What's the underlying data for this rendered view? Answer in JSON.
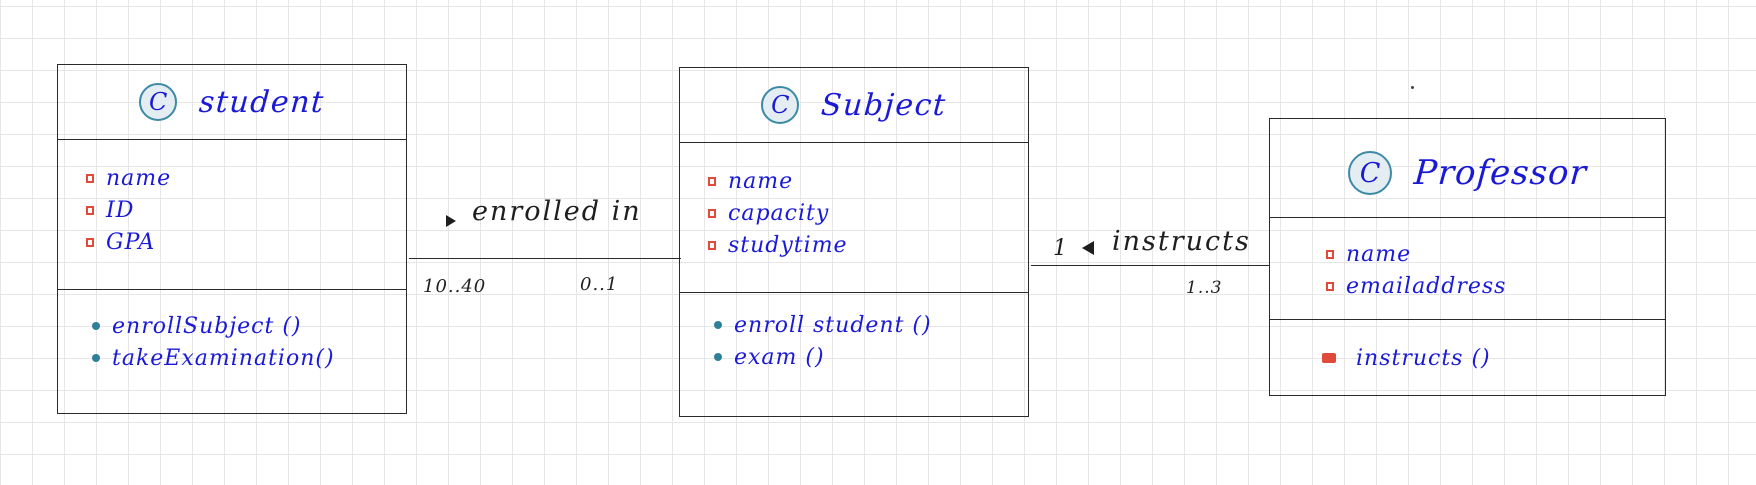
{
  "diagram": {
    "classes": [
      {
        "name": "student",
        "attributes": [
          "name",
          "ID",
          "GPA"
        ],
        "operations": [
          "enrollSubject ()",
          "takeExamination()"
        ]
      },
      {
        "name": "Subject",
        "attributes": [
          "name",
          "capacity",
          "studytime"
        ],
        "operations": [
          "enroll student ()",
          "exam ()"
        ]
      },
      {
        "name": "Professor",
        "attributes": [
          "name",
          "emailaddress"
        ],
        "operations": [
          "instructs ()"
        ]
      }
    ],
    "badge_letter": "C",
    "associations": [
      {
        "label": "enrolled  in",
        "direction": "right",
        "from_multiplicity": "10..40",
        "to_multiplicity": "0..1"
      },
      {
        "label": "instructs",
        "direction": "left",
        "from_multiplicity": "1",
        "to_multiplicity": "1..3"
      }
    ]
  },
  "colors": {
    "ink": "#1a1ad6",
    "line": "#2a2a2a",
    "attribute_marker": "#e04a3a",
    "operation_marker": "#2f7f99",
    "badge_border": "#3d8aa6",
    "badge_fill": "#e4edf2",
    "grid": "#e6e6e6"
  },
  "icons": {
    "class_badge": "class-c-badge-icon",
    "attribute": "private-attribute-square-icon",
    "operation": "public-operation-dot-icon",
    "protected_operation": "filled-square-operation-icon",
    "navigation_right": "triangle-right-icon",
    "navigation_left": "triangle-left-icon"
  }
}
